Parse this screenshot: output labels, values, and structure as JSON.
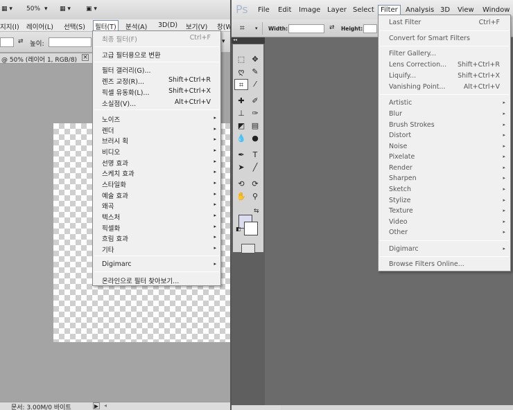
{
  "left": {
    "top_toolbar": {
      "zoom": "50%"
    },
    "menubar": [
      "지지(I)",
      "레이어(L)",
      "선택(S)",
      "필터(T)",
      "분석(A)",
      "3D(D)",
      "보기(V)",
      "창(W)"
    ],
    "active_menu": "필터(T)",
    "options": {
      "height_label": "높이:"
    },
    "doc_tab": "@ 50% (레이어 1, RGB/8)",
    "status": "문서: 3.00M/0 바이트",
    "filter_menu": {
      "last_filter": {
        "label": "최종 필터(F)",
        "shortcut": "Ctrl+F"
      },
      "convert": "고급 필터용으로 변환",
      "group2": [
        {
          "label": "필터 갤러리(G)...",
          "shortcut": ""
        },
        {
          "label": "렌즈 교정(R)...",
          "shortcut": "Shift+Ctrl+R"
        },
        {
          "label": "픽셀 유동화(L)...",
          "shortcut": "Shift+Ctrl+X"
        },
        {
          "label": "소실점(V)...",
          "shortcut": "Alt+Ctrl+V"
        }
      ],
      "submenus": [
        "노이즈",
        "렌더",
        "브러시 획",
        "비디오",
        "선명 효과",
        "스케치 효과",
        "스타일화",
        "예술 효과",
        "왜곡",
        "텍스처",
        "픽셀화",
        "흐림 효과",
        "기타"
      ],
      "digimarc": "Digimarc",
      "browse": "온라인으로 필터 찾아보기..."
    }
  },
  "right": {
    "logo": "Ps",
    "menubar": [
      "File",
      "Edit",
      "Image",
      "Layer",
      "Select",
      "Filter",
      "Analysis",
      "3D",
      "View",
      "Window"
    ],
    "active_menu": "Filter",
    "options": {
      "width_label": "Width:",
      "height_label": "Height:"
    },
    "filter_menu": {
      "last_filter": {
        "label": "Last Filter",
        "shortcut": "Ctrl+F"
      },
      "convert": "Convert for Smart Filters",
      "group2": [
        {
          "label": "Filter Gallery...",
          "shortcut": ""
        },
        {
          "label": "Lens Correction...",
          "shortcut": "Shift+Ctrl+R"
        },
        {
          "label": "Liquify...",
          "shortcut": "Shift+Ctrl+X"
        },
        {
          "label": "Vanishing Point...",
          "shortcut": "Alt+Ctrl+V"
        }
      ],
      "submenus": [
        "Artistic",
        "Blur",
        "Brush Strokes",
        "Distort",
        "Noise",
        "Pixelate",
        "Render",
        "Sharpen",
        "Sketch",
        "Stylize",
        "Texture",
        "Video",
        "Other"
      ],
      "digimarc": "Digimarc",
      "browse": "Browse Filters Online..."
    }
  },
  "icons": {
    "submenu_arrow": "▸",
    "dropdown": "▾"
  }
}
